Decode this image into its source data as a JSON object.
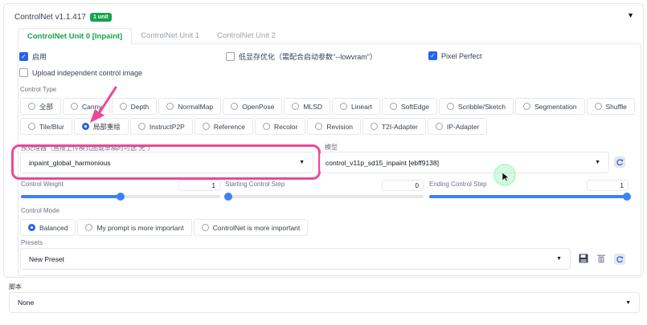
{
  "header": {
    "title": "ControlNet v1.1.417",
    "badge": "1 unit"
  },
  "tabs": [
    "ControlNet Unit 0 [Inpaint]",
    "ControlNet Unit 1",
    "ControlNet Unit 2"
  ],
  "checks": {
    "enable": "启用",
    "lowvram": "低显存优化（需配合启动参数\"--lowvram\"）",
    "pixel_perfect": "Pixel Perfect",
    "upload": "Upload independent control image"
  },
  "control_type": {
    "label": "Control Type",
    "row1": [
      "全部",
      "Canny",
      "Depth",
      "NormalMap",
      "OpenPose",
      "MLSD",
      "Lineart",
      "SoftEdge",
      "Scribble/Sketch",
      "Segmentation",
      "Shuffle"
    ],
    "row2": [
      "Tile/Blur",
      "局部重绘",
      "InstructP2P",
      "Reference",
      "Recolor",
      "Revision",
      "T2I-Adapter",
      "IP-Adapter"
    ],
    "selected": "局部重绘"
  },
  "preprocessor": {
    "label": "预处理器（直接上传模式图或草稿时可选“无”）",
    "value": "inpaint_global_harmonious"
  },
  "model": {
    "label": "模型",
    "value": "control_v11p_sd15_inpaint [ebff9138]"
  },
  "weights": {
    "control_weight": {
      "label": "Control Weight",
      "value": "1"
    },
    "start_step": {
      "label": "Starting Control Step",
      "value": "0"
    },
    "end_step": {
      "label": "Ending Control Step",
      "value": "1"
    }
  },
  "control_mode": {
    "label": "Control Mode",
    "options": [
      "Balanced",
      "My prompt is more important",
      "ControlNet is more important"
    ],
    "selected": "Balanced"
  },
  "presets": {
    "label": "Presets",
    "value": "New Preset"
  },
  "script": {
    "label": "脚本",
    "value": "None"
  },
  "colors": {
    "accent": "#16a34a",
    "primary": "#2563eb",
    "highlight": "#ec4899"
  }
}
